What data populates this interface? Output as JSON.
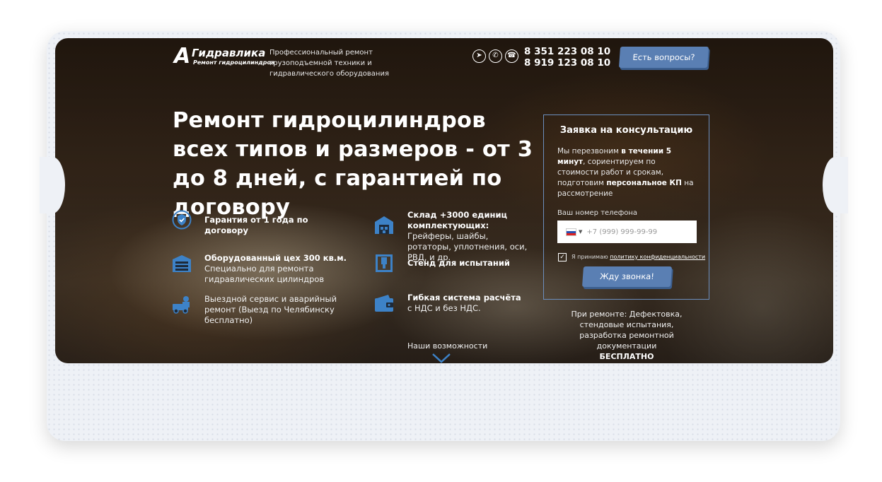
{
  "header": {
    "logo_letter": "А",
    "logo_title": "Гидравлика",
    "logo_subtitle": "Ремонт гидроцилиндров",
    "tagline": "Профессиональный ремонт грузоподъемной техники и гидравлического оборудования",
    "phone_1": "8 351 223 08 10",
    "phone_2": "8 919 123 08 10",
    "contact_icons": [
      "telegram-icon",
      "whatsapp-icon",
      "viber-icon"
    ],
    "question_button": "Есть вопросы?"
  },
  "hero": {
    "headline": "Ремонт гидроцилиндров всех типов и размеров - от 3 до 8 дней, с гарантией по договору"
  },
  "features": [
    {
      "icon": "shield-check-icon",
      "bold": "Гарантия от 1 года по договору",
      "text": ""
    },
    {
      "icon": "warehouse-icon",
      "bold": "Склад +3000 единиц комплектующих:",
      "text": "Грейферы, шайбы, ротаторы, уплотнения, оси, РВД, и др."
    },
    {
      "icon": "factory-icon",
      "bold": "Оборудованный цех 300 кв.м.",
      "text": "Специально для ремонта гидравлических цилиндров"
    },
    {
      "icon": "test-stand-icon",
      "bold": "Стенд для испытаний",
      "text": ""
    },
    {
      "icon": "service-truck-icon",
      "bold": "",
      "text": "Выездной сервис и аварийный ремонт (Выезд по Челябинску бесплатно)"
    },
    {
      "icon": "wallet-icon",
      "bold": "Гибкая система расчёта",
      "text": "с НДС и без НДС."
    }
  ],
  "form": {
    "title": "Заявка на консультацию",
    "text_1": "Мы перезвоним ",
    "text_bold_1": "в течении 5 минут",
    "text_2": ", сориентируем по стоимости работ и срокам, подготовим ",
    "text_bold_2": "персональное КП",
    "text_3": " на рассмотрение",
    "phone_label": "Ваш номер телефона",
    "phone_prefix": "+7",
    "phone_placeholder": "(999) 999-99-99",
    "agree_text": "Я принимаю ",
    "agree_link": "политику конфиденциальности",
    "agree_checked": true,
    "submit": "Жду звонка!"
  },
  "repair_note": {
    "text": "При ремонте: Дефектовка, стендовые испытания, разработка ремонтной документации",
    "bold": "БЕСПЛАТНО"
  },
  "more_link": "Наши возможности",
  "colors": {
    "accent": "#5a7fb3",
    "icon_blue": "#3d82c7",
    "form_border": "#6c8fbf"
  }
}
